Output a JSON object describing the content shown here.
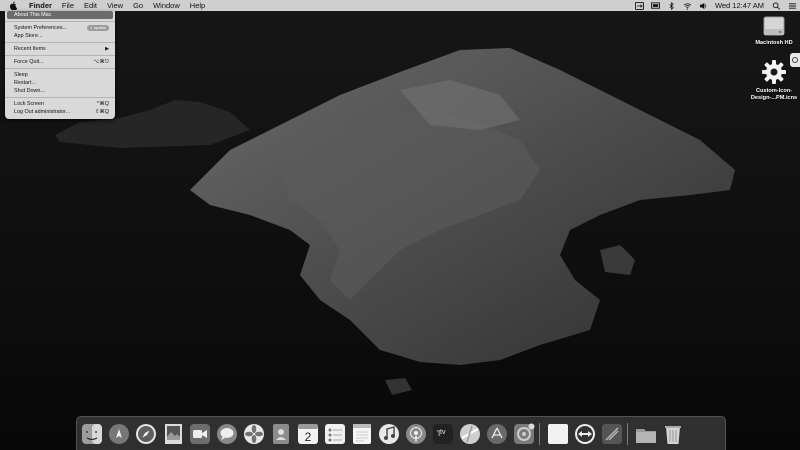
{
  "menubar": {
    "items": [
      "Finder",
      "File",
      "Edit",
      "View",
      "Go",
      "Window",
      "Help"
    ],
    "clock": "Wed 12:47 AM"
  },
  "apple_menu": {
    "about": "About This Mac",
    "system_prefs": "System Preferences...",
    "system_prefs_badge": "1 update",
    "app_store": "App Store...",
    "recent_items": "Recent Items",
    "force_quit": "Force Quit...",
    "force_quit_shortcut": "⌥⌘⎋",
    "sleep": "Sleep",
    "restart": "Restart...",
    "shut_down": "Shut Down...",
    "lock_screen": "Lock Screen",
    "lock_screen_shortcut": "^⌘Q",
    "log_out": "Log Out administrator...",
    "log_out_shortcut": "⇧⌘Q"
  },
  "desktop": {
    "icons": [
      {
        "label": "Macintosh HD",
        "icon": "hard-drive-icon"
      },
      {
        "label_line1": "Custom-Icon-",
        "label_line2": "Design-...PM.icns",
        "icon": "gear-icon"
      }
    ]
  },
  "dock": {
    "apps": [
      "finder-icon",
      "launchpad-icon",
      "safari-icon",
      "photo-preview-icon",
      "facetime-icon",
      "messages-icon",
      "photos-icon",
      "contacts-icon",
      "calendar-icon",
      "reminders-icon",
      "notes-icon",
      "music-icon",
      "podcasts-icon",
      "tv-icon",
      "maps-icon",
      "app-store-icon",
      "system-preferences-icon",
      "blank-app-icon",
      "teamviewer-icon",
      "utility-app-icon",
      "downloads-folder-icon",
      "trash-icon"
    ],
    "calendar_day": "2",
    "tv_label": "tv"
  },
  "colors": {
    "menubar_bg": "#cfcfcf",
    "dropdown_bg": "#d9d9d9",
    "highlight": "#6b6b6b"
  }
}
